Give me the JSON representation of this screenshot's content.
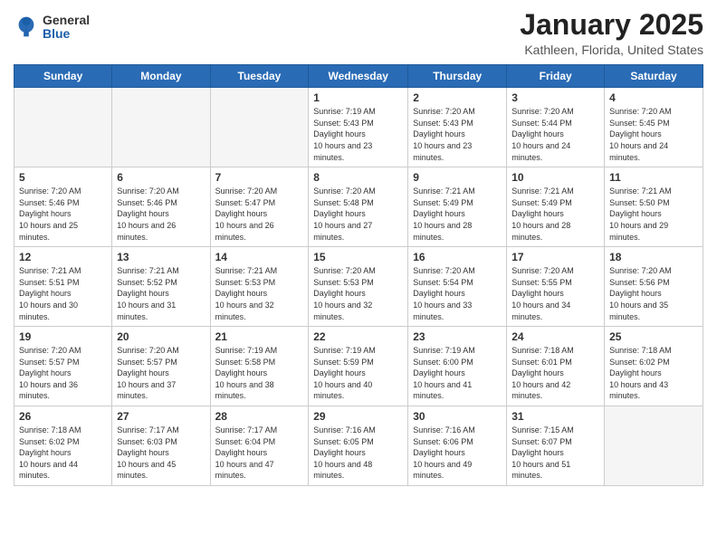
{
  "header": {
    "logo": {
      "general": "General",
      "blue": "Blue"
    },
    "title": "January 2025",
    "location": "Kathleen, Florida, United States"
  },
  "weekdays": [
    "Sunday",
    "Monday",
    "Tuesday",
    "Wednesday",
    "Thursday",
    "Friday",
    "Saturday"
  ],
  "weeks": [
    [
      {
        "day": "",
        "empty": true
      },
      {
        "day": "",
        "empty": true
      },
      {
        "day": "",
        "empty": true
      },
      {
        "day": "1",
        "sunrise": "Sunrise: 7:19 AM",
        "sunset": "Sunset: 5:43 PM",
        "daylight": "Daylight: 10 hours and 23 minutes."
      },
      {
        "day": "2",
        "sunrise": "Sunrise: 7:20 AM",
        "sunset": "Sunset: 5:43 PM",
        "daylight": "Daylight: 10 hours and 23 minutes."
      },
      {
        "day": "3",
        "sunrise": "Sunrise: 7:20 AM",
        "sunset": "Sunset: 5:44 PM",
        "daylight": "Daylight: 10 hours and 24 minutes."
      },
      {
        "day": "4",
        "sunrise": "Sunrise: 7:20 AM",
        "sunset": "Sunset: 5:45 PM",
        "daylight": "Daylight: 10 hours and 24 minutes."
      }
    ],
    [
      {
        "day": "5",
        "sunrise": "Sunrise: 7:20 AM",
        "sunset": "Sunset: 5:46 PM",
        "daylight": "Daylight: 10 hours and 25 minutes."
      },
      {
        "day": "6",
        "sunrise": "Sunrise: 7:20 AM",
        "sunset": "Sunset: 5:46 PM",
        "daylight": "Daylight: 10 hours and 26 minutes."
      },
      {
        "day": "7",
        "sunrise": "Sunrise: 7:20 AM",
        "sunset": "Sunset: 5:47 PM",
        "daylight": "Daylight: 10 hours and 26 minutes."
      },
      {
        "day": "8",
        "sunrise": "Sunrise: 7:20 AM",
        "sunset": "Sunset: 5:48 PM",
        "daylight": "Daylight: 10 hours and 27 minutes."
      },
      {
        "day": "9",
        "sunrise": "Sunrise: 7:21 AM",
        "sunset": "Sunset: 5:49 PM",
        "daylight": "Daylight: 10 hours and 28 minutes."
      },
      {
        "day": "10",
        "sunrise": "Sunrise: 7:21 AM",
        "sunset": "Sunset: 5:49 PM",
        "daylight": "Daylight: 10 hours and 28 minutes."
      },
      {
        "day": "11",
        "sunrise": "Sunrise: 7:21 AM",
        "sunset": "Sunset: 5:50 PM",
        "daylight": "Daylight: 10 hours and 29 minutes."
      }
    ],
    [
      {
        "day": "12",
        "sunrise": "Sunrise: 7:21 AM",
        "sunset": "Sunset: 5:51 PM",
        "daylight": "Daylight: 10 hours and 30 minutes."
      },
      {
        "day": "13",
        "sunrise": "Sunrise: 7:21 AM",
        "sunset": "Sunset: 5:52 PM",
        "daylight": "Daylight: 10 hours and 31 minutes."
      },
      {
        "day": "14",
        "sunrise": "Sunrise: 7:21 AM",
        "sunset": "Sunset: 5:53 PM",
        "daylight": "Daylight: 10 hours and 32 minutes."
      },
      {
        "day": "15",
        "sunrise": "Sunrise: 7:20 AM",
        "sunset": "Sunset: 5:53 PM",
        "daylight": "Daylight: 10 hours and 32 minutes."
      },
      {
        "day": "16",
        "sunrise": "Sunrise: 7:20 AM",
        "sunset": "Sunset: 5:54 PM",
        "daylight": "Daylight: 10 hours and 33 minutes."
      },
      {
        "day": "17",
        "sunrise": "Sunrise: 7:20 AM",
        "sunset": "Sunset: 5:55 PM",
        "daylight": "Daylight: 10 hours and 34 minutes."
      },
      {
        "day": "18",
        "sunrise": "Sunrise: 7:20 AM",
        "sunset": "Sunset: 5:56 PM",
        "daylight": "Daylight: 10 hours and 35 minutes."
      }
    ],
    [
      {
        "day": "19",
        "sunrise": "Sunrise: 7:20 AM",
        "sunset": "Sunset: 5:57 PM",
        "daylight": "Daylight: 10 hours and 36 minutes."
      },
      {
        "day": "20",
        "sunrise": "Sunrise: 7:20 AM",
        "sunset": "Sunset: 5:57 PM",
        "daylight": "Daylight: 10 hours and 37 minutes."
      },
      {
        "day": "21",
        "sunrise": "Sunrise: 7:19 AM",
        "sunset": "Sunset: 5:58 PM",
        "daylight": "Daylight: 10 hours and 38 minutes."
      },
      {
        "day": "22",
        "sunrise": "Sunrise: 7:19 AM",
        "sunset": "Sunset: 5:59 PM",
        "daylight": "Daylight: 10 hours and 40 minutes."
      },
      {
        "day": "23",
        "sunrise": "Sunrise: 7:19 AM",
        "sunset": "Sunset: 6:00 PM",
        "daylight": "Daylight: 10 hours and 41 minutes."
      },
      {
        "day": "24",
        "sunrise": "Sunrise: 7:18 AM",
        "sunset": "Sunset: 6:01 PM",
        "daylight": "Daylight: 10 hours and 42 minutes."
      },
      {
        "day": "25",
        "sunrise": "Sunrise: 7:18 AM",
        "sunset": "Sunset: 6:02 PM",
        "daylight": "Daylight: 10 hours and 43 minutes."
      }
    ],
    [
      {
        "day": "26",
        "sunrise": "Sunrise: 7:18 AM",
        "sunset": "Sunset: 6:02 PM",
        "daylight": "Daylight: 10 hours and 44 minutes."
      },
      {
        "day": "27",
        "sunrise": "Sunrise: 7:17 AM",
        "sunset": "Sunset: 6:03 PM",
        "daylight": "Daylight: 10 hours and 45 minutes."
      },
      {
        "day": "28",
        "sunrise": "Sunrise: 7:17 AM",
        "sunset": "Sunset: 6:04 PM",
        "daylight": "Daylight: 10 hours and 47 minutes."
      },
      {
        "day": "29",
        "sunrise": "Sunrise: 7:16 AM",
        "sunset": "Sunset: 6:05 PM",
        "daylight": "Daylight: 10 hours and 48 minutes."
      },
      {
        "day": "30",
        "sunrise": "Sunrise: 7:16 AM",
        "sunset": "Sunset: 6:06 PM",
        "daylight": "Daylight: 10 hours and 49 minutes."
      },
      {
        "day": "31",
        "sunrise": "Sunrise: 7:15 AM",
        "sunset": "Sunset: 6:07 PM",
        "daylight": "Daylight: 10 hours and 51 minutes."
      },
      {
        "day": "",
        "empty": true
      }
    ]
  ]
}
